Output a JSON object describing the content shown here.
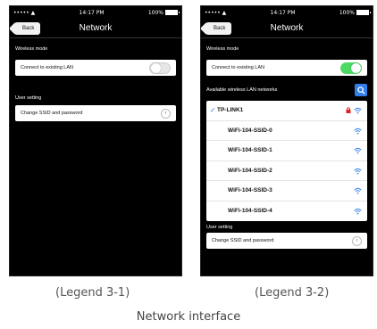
{
  "phones": [
    {
      "status": {
        "signal": "••••• ▲",
        "time": "14:17 PM",
        "battery": "100%"
      },
      "back_label": "Back",
      "title": "Network",
      "wireless_mode_label": "Wireless mode",
      "connect_label": "Connect to existing LAN",
      "connect_toggle": "off",
      "user_setting_label": "User setting",
      "change_label": "Change SSID and password"
    },
    {
      "status": {
        "signal": "••••• ▲",
        "time": "14:17 PM",
        "battery": "100%"
      },
      "back_label": "Back",
      "title": "Network",
      "wireless_mode_label": "Wireless mode",
      "connect_label": "Connect to existing LAN",
      "connect_toggle": "on",
      "available_label": "Available wireless LAN networks",
      "networks": [
        {
          "name": "TP-LINK1",
          "selected": true,
          "locked": true
        },
        {
          "name": "WiFi-104-SSID-0",
          "selected": false,
          "locked": false
        },
        {
          "name": "WiFi-104-SSID-1",
          "selected": false,
          "locked": false
        },
        {
          "name": "WiFi-104-SSID-2",
          "selected": false,
          "locked": false
        },
        {
          "name": "WiFi-104-SSID-3",
          "selected": false,
          "locked": false
        },
        {
          "name": "WiFi-104-SSID-4",
          "selected": false,
          "locked": false
        }
      ],
      "user_setting_label": "User setting",
      "change_label": "Change SSID and password"
    }
  ],
  "captions": {
    "left": "(Legend 3-1)",
    "right": "(Legend 3-2)",
    "bottom": "Network interface"
  },
  "colors": {
    "toggle_on": "#4cd964",
    "accent": "#2f80ed",
    "lock": "#e02020"
  }
}
